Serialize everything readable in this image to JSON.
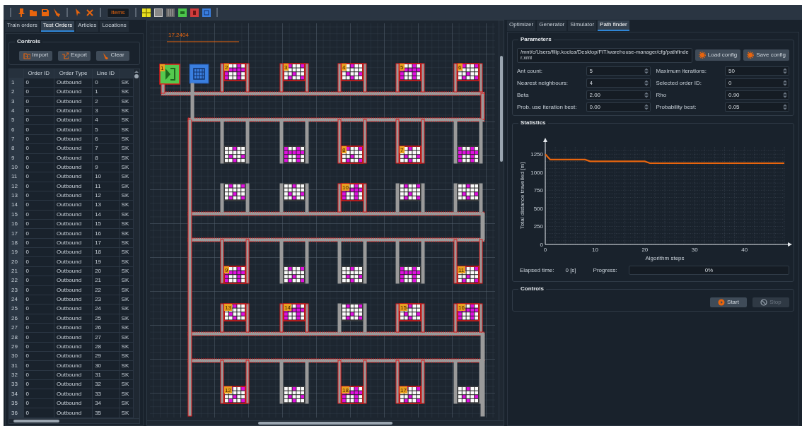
{
  "toolbar": {
    "items_button": "Items"
  },
  "left_panel": {
    "tabs": [
      {
        "label": "Train orders",
        "selected": false
      },
      {
        "label": "Test Orders",
        "selected": true
      },
      {
        "label": "Articles",
        "selected": false
      },
      {
        "label": "Locations",
        "selected": false
      }
    ],
    "controls": {
      "title": "Controls",
      "buttons": [
        {
          "label": "Import",
          "kind": "import"
        },
        {
          "label": "Export",
          "kind": "export"
        },
        {
          "label": "Clear",
          "kind": "clear"
        }
      ]
    },
    "table": {
      "columns": [
        "Order ID",
        "Order Type",
        "Line ID"
      ],
      "rows": [
        {
          "n": "1",
          "order_id": "0",
          "order_type": "Outbound",
          "line_id": "0",
          "column_5": "SK"
        },
        {
          "n": "2",
          "order_id": "0",
          "order_type": "Outbound",
          "line_id": "1",
          "column_5": "SK"
        },
        {
          "n": "3",
          "order_id": "0",
          "order_type": "Outbound",
          "line_id": "2",
          "column_5": "SK"
        },
        {
          "n": "4",
          "order_id": "0",
          "order_type": "Outbound",
          "line_id": "3",
          "column_5": "SK"
        },
        {
          "n": "5",
          "order_id": "0",
          "order_type": "Outbound",
          "line_id": "4",
          "column_5": "SK"
        },
        {
          "n": "6",
          "order_id": "0",
          "order_type": "Outbound",
          "line_id": "5",
          "column_5": "SK"
        },
        {
          "n": "7",
          "order_id": "0",
          "order_type": "Outbound",
          "line_id": "6",
          "column_5": "SK"
        },
        {
          "n": "8",
          "order_id": "0",
          "order_type": "Outbound",
          "line_id": "7",
          "column_5": "SK"
        },
        {
          "n": "9",
          "order_id": "0",
          "order_type": "Outbound",
          "line_id": "8",
          "column_5": "SK"
        },
        {
          "n": "10",
          "order_id": "0",
          "order_type": "Outbound",
          "line_id": "9",
          "column_5": "SK"
        },
        {
          "n": "11",
          "order_id": "0",
          "order_type": "Outbound",
          "line_id": "10",
          "column_5": "SK"
        },
        {
          "n": "12",
          "order_id": "0",
          "order_type": "Outbound",
          "line_id": "11",
          "column_5": "SK"
        },
        {
          "n": "13",
          "order_id": "0",
          "order_type": "Outbound",
          "line_id": "12",
          "column_5": "SK"
        },
        {
          "n": "14",
          "order_id": "0",
          "order_type": "Outbound",
          "line_id": "13",
          "column_5": "SK"
        },
        {
          "n": "15",
          "order_id": "0",
          "order_type": "Outbound",
          "line_id": "14",
          "column_5": "SK"
        },
        {
          "n": "16",
          "order_id": "0",
          "order_type": "Outbound",
          "line_id": "15",
          "column_5": "SK"
        },
        {
          "n": "17",
          "order_id": "0",
          "order_type": "Outbound",
          "line_id": "16",
          "column_5": "SK"
        },
        {
          "n": "18",
          "order_id": "0",
          "order_type": "Outbound",
          "line_id": "17",
          "column_5": "SK"
        },
        {
          "n": "19",
          "order_id": "0",
          "order_type": "Outbound",
          "line_id": "18",
          "column_5": "SK"
        },
        {
          "n": "20",
          "order_id": "0",
          "order_type": "Outbound",
          "line_id": "19",
          "column_5": "SK"
        },
        {
          "n": "21",
          "order_id": "0",
          "order_type": "Outbound",
          "line_id": "20",
          "column_5": "SK"
        },
        {
          "n": "22",
          "order_id": "0",
          "order_type": "Outbound",
          "line_id": "21",
          "column_5": "SK"
        },
        {
          "n": "23",
          "order_id": "0",
          "order_type": "Outbound",
          "line_id": "22",
          "column_5": "SK"
        },
        {
          "n": "24",
          "order_id": "0",
          "order_type": "Outbound",
          "line_id": "23",
          "column_5": "SK"
        },
        {
          "n": "25",
          "order_id": "0",
          "order_type": "Outbound",
          "line_id": "24",
          "column_5": "SK"
        },
        {
          "n": "26",
          "order_id": "0",
          "order_type": "Outbound",
          "line_id": "25",
          "column_5": "SK"
        },
        {
          "n": "27",
          "order_id": "0",
          "order_type": "Outbound",
          "line_id": "26",
          "column_5": "SK"
        },
        {
          "n": "28",
          "order_id": "0",
          "order_type": "Outbound",
          "line_id": "27",
          "column_5": "SK"
        },
        {
          "n": "29",
          "order_id": "0",
          "order_type": "Outbound",
          "line_id": "28",
          "column_5": "SK"
        },
        {
          "n": "30",
          "order_id": "0",
          "order_type": "Outbound",
          "line_id": "29",
          "column_5": "SK"
        },
        {
          "n": "31",
          "order_id": "0",
          "order_type": "Outbound",
          "line_id": "30",
          "column_5": "SK"
        },
        {
          "n": "32",
          "order_id": "0",
          "order_type": "Outbound",
          "line_id": "31",
          "column_5": "SK"
        },
        {
          "n": "33",
          "order_id": "0",
          "order_type": "Outbound",
          "line_id": "32",
          "column_5": "SK"
        },
        {
          "n": "34",
          "order_id": "0",
          "order_type": "Outbound",
          "line_id": "33",
          "column_5": "SK"
        },
        {
          "n": "35",
          "order_id": "0",
          "order_type": "Outbound",
          "line_id": "34",
          "column_5": "SK"
        },
        {
          "n": "36",
          "order_id": "0",
          "order_type": "Outbound",
          "line_id": "35",
          "column_5": "SK"
        }
      ]
    }
  },
  "canvas": {
    "scale_label": "17.2404",
    "entrance": {
      "label": "1"
    },
    "shelves": [
      {
        "label": "2",
        "on_route": true
      },
      {
        "label": "3",
        "on_route": true
      },
      {
        "label": "4",
        "on_route": true
      },
      {
        "label": "5",
        "on_route": true
      },
      {
        "label": "6",
        "on_route": true
      },
      {
        "on_route": false
      },
      {
        "on_route": false
      },
      {
        "label": "8",
        "on_route": true
      },
      {
        "label": "7",
        "on_route": true
      },
      {
        "on_route": false
      },
      {
        "on_route": false
      },
      {
        "on_route": false
      },
      {
        "label": "10",
        "on_route": true
      },
      {
        "on_route": false
      },
      {
        "on_route": false
      },
      {
        "label": "9",
        "on_route": true
      },
      {
        "on_route": false
      },
      {
        "on_route": false
      },
      {
        "on_route": false
      },
      {
        "label": "11",
        "on_route": true
      },
      {
        "label": "13",
        "on_route": true
      },
      {
        "label": "14",
        "on_route": true
      },
      {
        "on_route": false
      },
      {
        "label": "15",
        "on_route": true
      },
      {
        "label": "16",
        "on_route": true
      },
      {
        "label": "12",
        "on_route": true
      },
      {
        "on_route": false
      },
      {
        "label": "18",
        "on_route": true
      },
      {
        "label": "17",
        "on_route": true
      },
      {
        "on_route": false
      }
    ]
  },
  "right_panel": {
    "tabs": [
      {
        "label": "Optimizer",
        "selected": false
      },
      {
        "label": "Generator",
        "selected": false
      },
      {
        "label": "Simulator",
        "selected": false
      },
      {
        "label": "Path finder",
        "selected": true
      }
    ],
    "parameters": {
      "title": "Parameters",
      "config_path": "/mnt/c/Users/filip.kocica/Desktop/FIT/warehouse-manager/cfg/pathfinder.xml",
      "load_button": "Load config",
      "save_button": "Save config",
      "fields": [
        {
          "label": "Ant count:",
          "value": "5"
        },
        {
          "label": "Maximum iterations:",
          "value": "50"
        },
        {
          "label": "Nearest neighbours:",
          "value": "4"
        },
        {
          "label": "Selected order ID:",
          "value": "0"
        },
        {
          "label": "Beta",
          "value": "2.00"
        },
        {
          "label": "Rho",
          "value": "0.90"
        },
        {
          "label": "Prob. use iteration best:",
          "value": "0.00"
        },
        {
          "label": "Probability best:",
          "value": "0.05"
        }
      ]
    },
    "statistics": {
      "title": "Statistics",
      "chart_data": {
        "type": "line",
        "xlabel": "Algorithm steps",
        "ylabel": "Total distance travelled [m]",
        "x": [
          0,
          1,
          8,
          9,
          20,
          21,
          48
        ],
        "series": [
          {
            "color": "#e8650e",
            "values": [
              1250,
              1175,
              1175,
              1150,
              1150,
              1125,
              1125
            ]
          }
        ],
        "grid": true,
        "xlim": [
          0,
          48
        ],
        "ylim": [
          0,
          1350
        ],
        "xticks": [
          0,
          10,
          20,
          30,
          40
        ],
        "yticks": [
          0,
          250,
          500,
          750,
          1000,
          1250
        ]
      },
      "elapsed_label": "Elapsed time:",
      "elapsed_value": "0 [s]",
      "progress_label": "Progress:",
      "progress": {
        "level": 0,
        "text": "0%"
      }
    },
    "controls": {
      "title": "Controls",
      "start_button": {
        "label": "Start",
        "disabled": false
      },
      "stop_button": {
        "label": "Stop",
        "disabled": true
      }
    }
  }
}
